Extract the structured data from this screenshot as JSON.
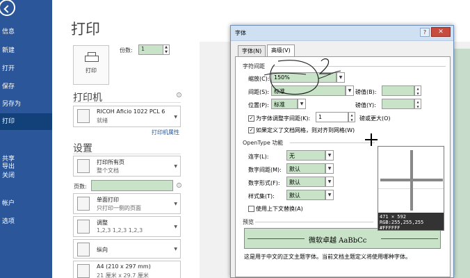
{
  "sidebar": {
    "items": [
      {
        "label": "信息"
      },
      {
        "label": "新建"
      },
      {
        "label": "打开"
      },
      {
        "label": "保存"
      },
      {
        "label": "另存为"
      },
      {
        "label": "打印"
      },
      {
        "label": "共享"
      },
      {
        "label": "导出"
      },
      {
        "label": "关闭"
      },
      {
        "label": "帐户"
      },
      {
        "label": "选项"
      }
    ]
  },
  "print": {
    "title": "打印",
    "print_button": "打印",
    "copies_label": "份数:",
    "copies_value": "1",
    "printer_heading": "打印机",
    "printer_name": "RICOH Aficio 1022 PCL 6",
    "printer_status": "就绪",
    "printer_props": "打印机属性",
    "settings_heading": "设置",
    "opt1_t1": "打印所有页",
    "opt1_t2": "整个文档",
    "pages_label": "页数:",
    "opt2_t1": "单面打印",
    "opt2_t2": "只打印一侧的页面",
    "opt3_t1": "调整",
    "opt3_t2": "1,2,3    1,2,3    1,2,3",
    "opt4_t1": "纵向",
    "opt5_t1": "A4 (210 x 297 mm)",
    "opt5_t2": "21 厘米 x 29.7 厘米"
  },
  "dialog": {
    "title": "字体",
    "help": "?",
    "close": "✕",
    "tab_font": "字体(N)",
    "tab_advanced": "高级(V)",
    "spacing_group": "字符间距",
    "scale_label": "缩放(C):",
    "scale_value": "150%",
    "spacing_label": "间距(S):",
    "spacing_value": "标准",
    "spacing_by_label": "磅值(B):",
    "position_label": "位置(P):",
    "position_value": "标准",
    "position_by_label": "磅值(Y):",
    "kerning_label": "为字体调整字间距(K):",
    "kerning_value": "1",
    "kerning_unit": "磅或更大(O)",
    "grid_label": "如果定义了文档网格，则对齐到网格(W)",
    "opentype_group": "OpenType 功能",
    "ligatures_label": "连字(L):",
    "ligatures_value": "无",
    "numspacing_label": "数字间距(M):",
    "numspacing_value": "默认",
    "numform_label": "数字形式(F):",
    "numform_value": "默认",
    "stylesets_label": "样式集(T):",
    "stylesets_value": "默认",
    "contextual_label": "使用上下文替换(A)",
    "preview_group": "预览",
    "preview_text": "微软卓越 AaBbCc",
    "description": "这是用于中文的正文主题字体。当前文档主题定义将使用哪种字体。"
  },
  "magnifier": {
    "size": "471 × 592",
    "rgb": "RGB:255,255,255 #FFFFFF"
  },
  "handwriting": {
    "number": "2"
  },
  "colors": {
    "sidebar": "#2b579a",
    "field_green": "#c8e3c8"
  }
}
